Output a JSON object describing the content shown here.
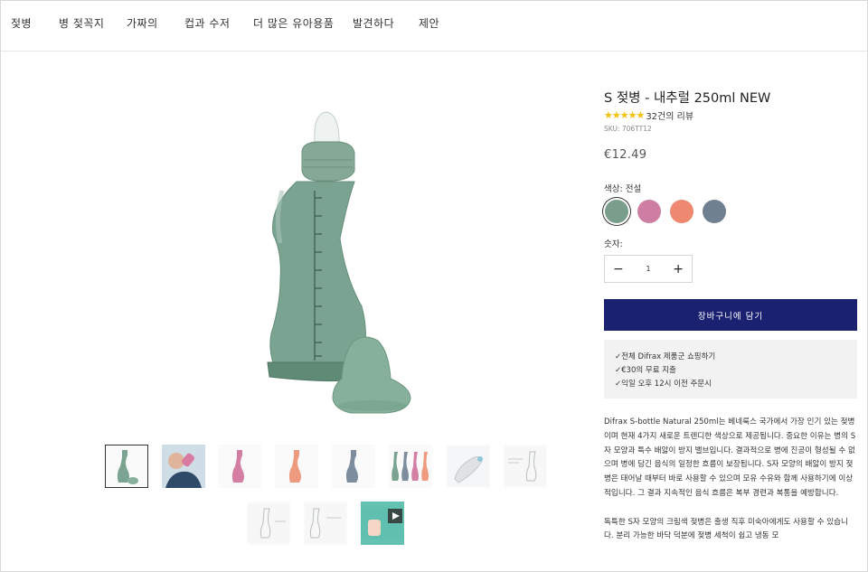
{
  "nav": {
    "items": [
      "젖병",
      "병 젖꼭지",
      "가짜의",
      "컵과 수저",
      "더 많은 유아용품",
      "발견하다",
      "제안"
    ]
  },
  "product": {
    "title": "S 젖병 - 내추럴 250ml NEW",
    "stars": "★★★★★",
    "reviews": "32건의 리뷰",
    "sku": "SKU: 706TT12",
    "price": "€12.49",
    "color_label": "색상: 전설",
    "colors": [
      "#7a9e8c",
      "#cf7ea3",
      "#ee8870",
      "#6f8091"
    ],
    "selected_color": 0,
    "qty_label": "숫자:",
    "qty_minus": "−",
    "qty_value": "1",
    "qty_plus": "+",
    "cart_label": "장바구니에 담기"
  },
  "info": {
    "lines": [
      "✓전체 Difrax 제품군 쇼핑하기",
      "✓€30의 무료 지출",
      "✓익일 오후 12시 이전 주문시"
    ]
  },
  "description": {
    "p1": "Difrax S-bottle Natural 250ml는 베네룩스 국가에서 가장 인기 있는 젖병이며 현재 4가지 새로운 트렌디한 색상으로 제공됩니다. 중요한 이유는 병의 S자 모양과 특수 배앓이 방지 밸브입니다. 결과적으로 병에 진공이 형성될 수 없으며 병에 담긴 음식의 일정한 흐름이 보장됩니다. S자 모양의 배앓이 방지 젖병은 태어날 때부터 바로 사용할 수 있으며 모유 수유와 함께 사용하기에 이상적입니다. 그 결과 지속적인 음식 흐름은 복부 경련과 복통을 예방합니다.",
    "p2": "독특한 S자 모양의 크림색 젖병은 출생 직후 미숙아에게도 사용할 수 있습니다. 분리 가능한 바닥 덕분에 젖병 세척이 쉽고 냉동 모"
  },
  "gallery": {
    "thumbnails": [
      "bottle-green",
      "child-drinking",
      "bottle-pink",
      "bottle-coral",
      "bottle-blue",
      "bottles-group",
      "bottle-accessory",
      "bottle-diagram",
      "bottle-parts-diagram",
      "bottle-outline",
      "video"
    ]
  }
}
